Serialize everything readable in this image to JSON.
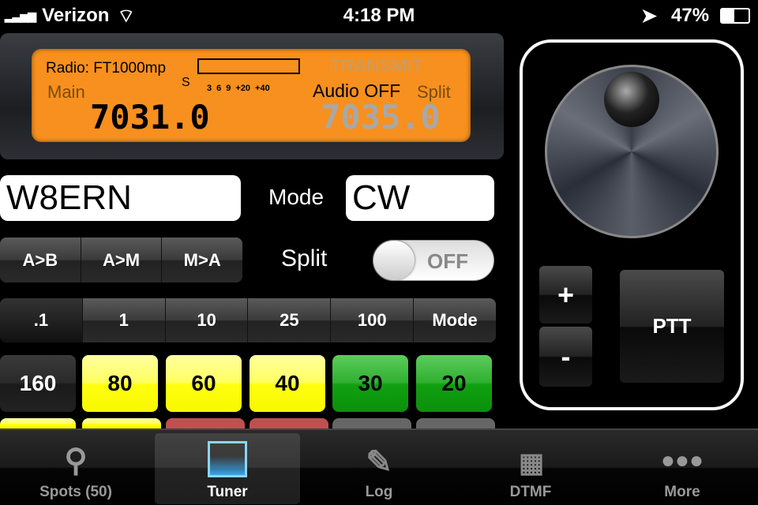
{
  "status": {
    "carrier": "Verizon",
    "time": "4:18 PM",
    "battery": "47%",
    "battery_level": 47
  },
  "display": {
    "radio": "Radio: FT1000mp",
    "transmit": "TRANSMIT",
    "main_label": "Main",
    "s_label": "S",
    "s_scale": [
      "3",
      "6",
      "9",
      "+20",
      "+40"
    ],
    "audio": "Audio OFF",
    "split_label": "Split",
    "main_freq": "7031.0",
    "split_freq": "7035.0"
  },
  "callsign": "W8ERN",
  "mode_label": "Mode",
  "mode_value": "CW",
  "vfo_buttons": [
    "A>B",
    "A>M",
    "M>A"
  ],
  "split": {
    "label": "Split",
    "toggle": "OFF"
  },
  "steps": [
    ".1",
    "1",
    "10",
    "25",
    "100",
    "Mode"
  ],
  "bands": [
    "160",
    "80",
    "60",
    "40",
    "30",
    "20"
  ],
  "controls": {
    "plus": "+",
    "minus": "-",
    "ptt": "PTT"
  },
  "tabs": [
    {
      "label": "Spots (50)",
      "icon": "pin-icon"
    },
    {
      "label": "Tuner",
      "icon": "tuner-icon"
    },
    {
      "label": "Log",
      "icon": "compose-icon"
    },
    {
      "label": "DTMF",
      "icon": "keypad-icon"
    },
    {
      "label": "More",
      "icon": "more-icon"
    }
  ],
  "colors": {
    "lcd": "#f7901e",
    "yellow": "#ffff30",
    "green": "#16a316",
    "red": "#c05050"
  }
}
